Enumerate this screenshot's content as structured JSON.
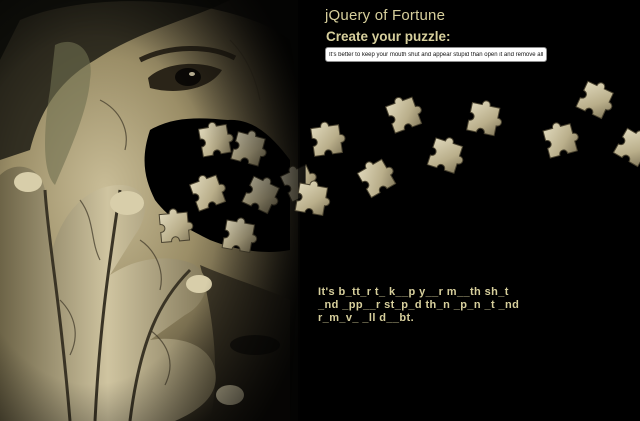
{
  "app": {
    "title": "jQuery of Fortune"
  },
  "form": {
    "label": "Create your puzzle:",
    "input_value": "It's better to keep your mouth shut and appear stupid than open it and remove all do"
  },
  "puzzle": {
    "lines": [
      "It's b_tt_r t_ k__p y__r m__th sh_t",
      "_nd _pp__r st_p_d th_n _p_n _t _nd",
      "r_m_v_ _ll d__bt."
    ]
  },
  "colors": {
    "text_accent": "#d7cf9c",
    "background": "#000000",
    "input_background": "#ffffff"
  }
}
